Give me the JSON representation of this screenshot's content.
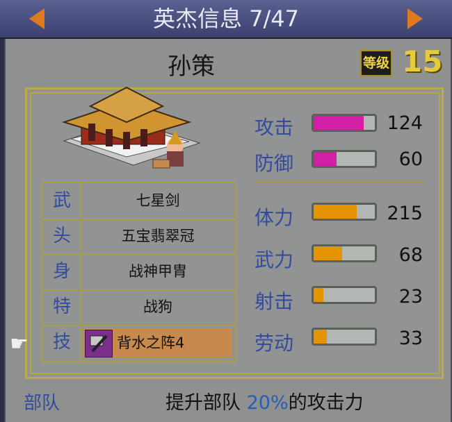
{
  "header": {
    "title": "英杰信息 7/47"
  },
  "hero": {
    "name": "孙策",
    "level_badge": "等级",
    "level": "15"
  },
  "equipment": [
    {
      "key": "武",
      "value": "七星剑"
    },
    {
      "key": "头",
      "value": "五宝翡翠冠"
    },
    {
      "key": "身",
      "value": "战神甲胄"
    },
    {
      "key": "特",
      "value": "战狗"
    },
    {
      "key": "技",
      "value": "背水之阵4"
    }
  ],
  "stats_top": [
    {
      "label": "攻击",
      "value": "124",
      "fill": 0.82,
      "color": "#d21fa6"
    },
    {
      "label": "防御",
      "value": "60",
      "fill": 0.38,
      "color": "#d21fa6"
    }
  ],
  "stats_bottom": [
    {
      "label": "体力",
      "value": "215",
      "fill": 0.7,
      "color": "#e49400"
    },
    {
      "label": "武力",
      "value": "68",
      "fill": 0.47,
      "color": "#e49400"
    },
    {
      "label": "射击",
      "value": "23",
      "fill": 0.16,
      "color": "#e49400"
    },
    {
      "label": "劳动",
      "value": "33",
      "fill": 0.22,
      "color": "#e49400"
    }
  ],
  "footer": {
    "label": "部队",
    "text_before": "提升部队 ",
    "highlight": "20%",
    "text_after": "的攻击力"
  },
  "icons": {
    "prev": "left-arrow-icon",
    "next": "right-arrow-icon",
    "pointer": "pointing-hand-icon",
    "skill": "axe-icon",
    "portrait": "palace-and-hero-sprite"
  }
}
